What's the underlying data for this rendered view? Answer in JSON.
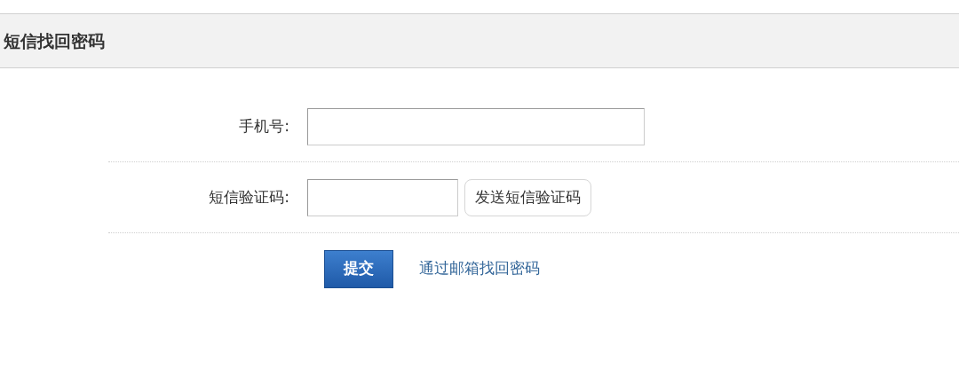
{
  "header": {
    "title": "短信找回密码"
  },
  "form": {
    "fields": [
      {
        "label": "手机号:",
        "kind": "phone"
      },
      {
        "label": "短信验证码:",
        "kind": "code",
        "button": "发送短信验证码"
      }
    ],
    "submit": "提交",
    "link": "通过邮箱找回密码"
  }
}
